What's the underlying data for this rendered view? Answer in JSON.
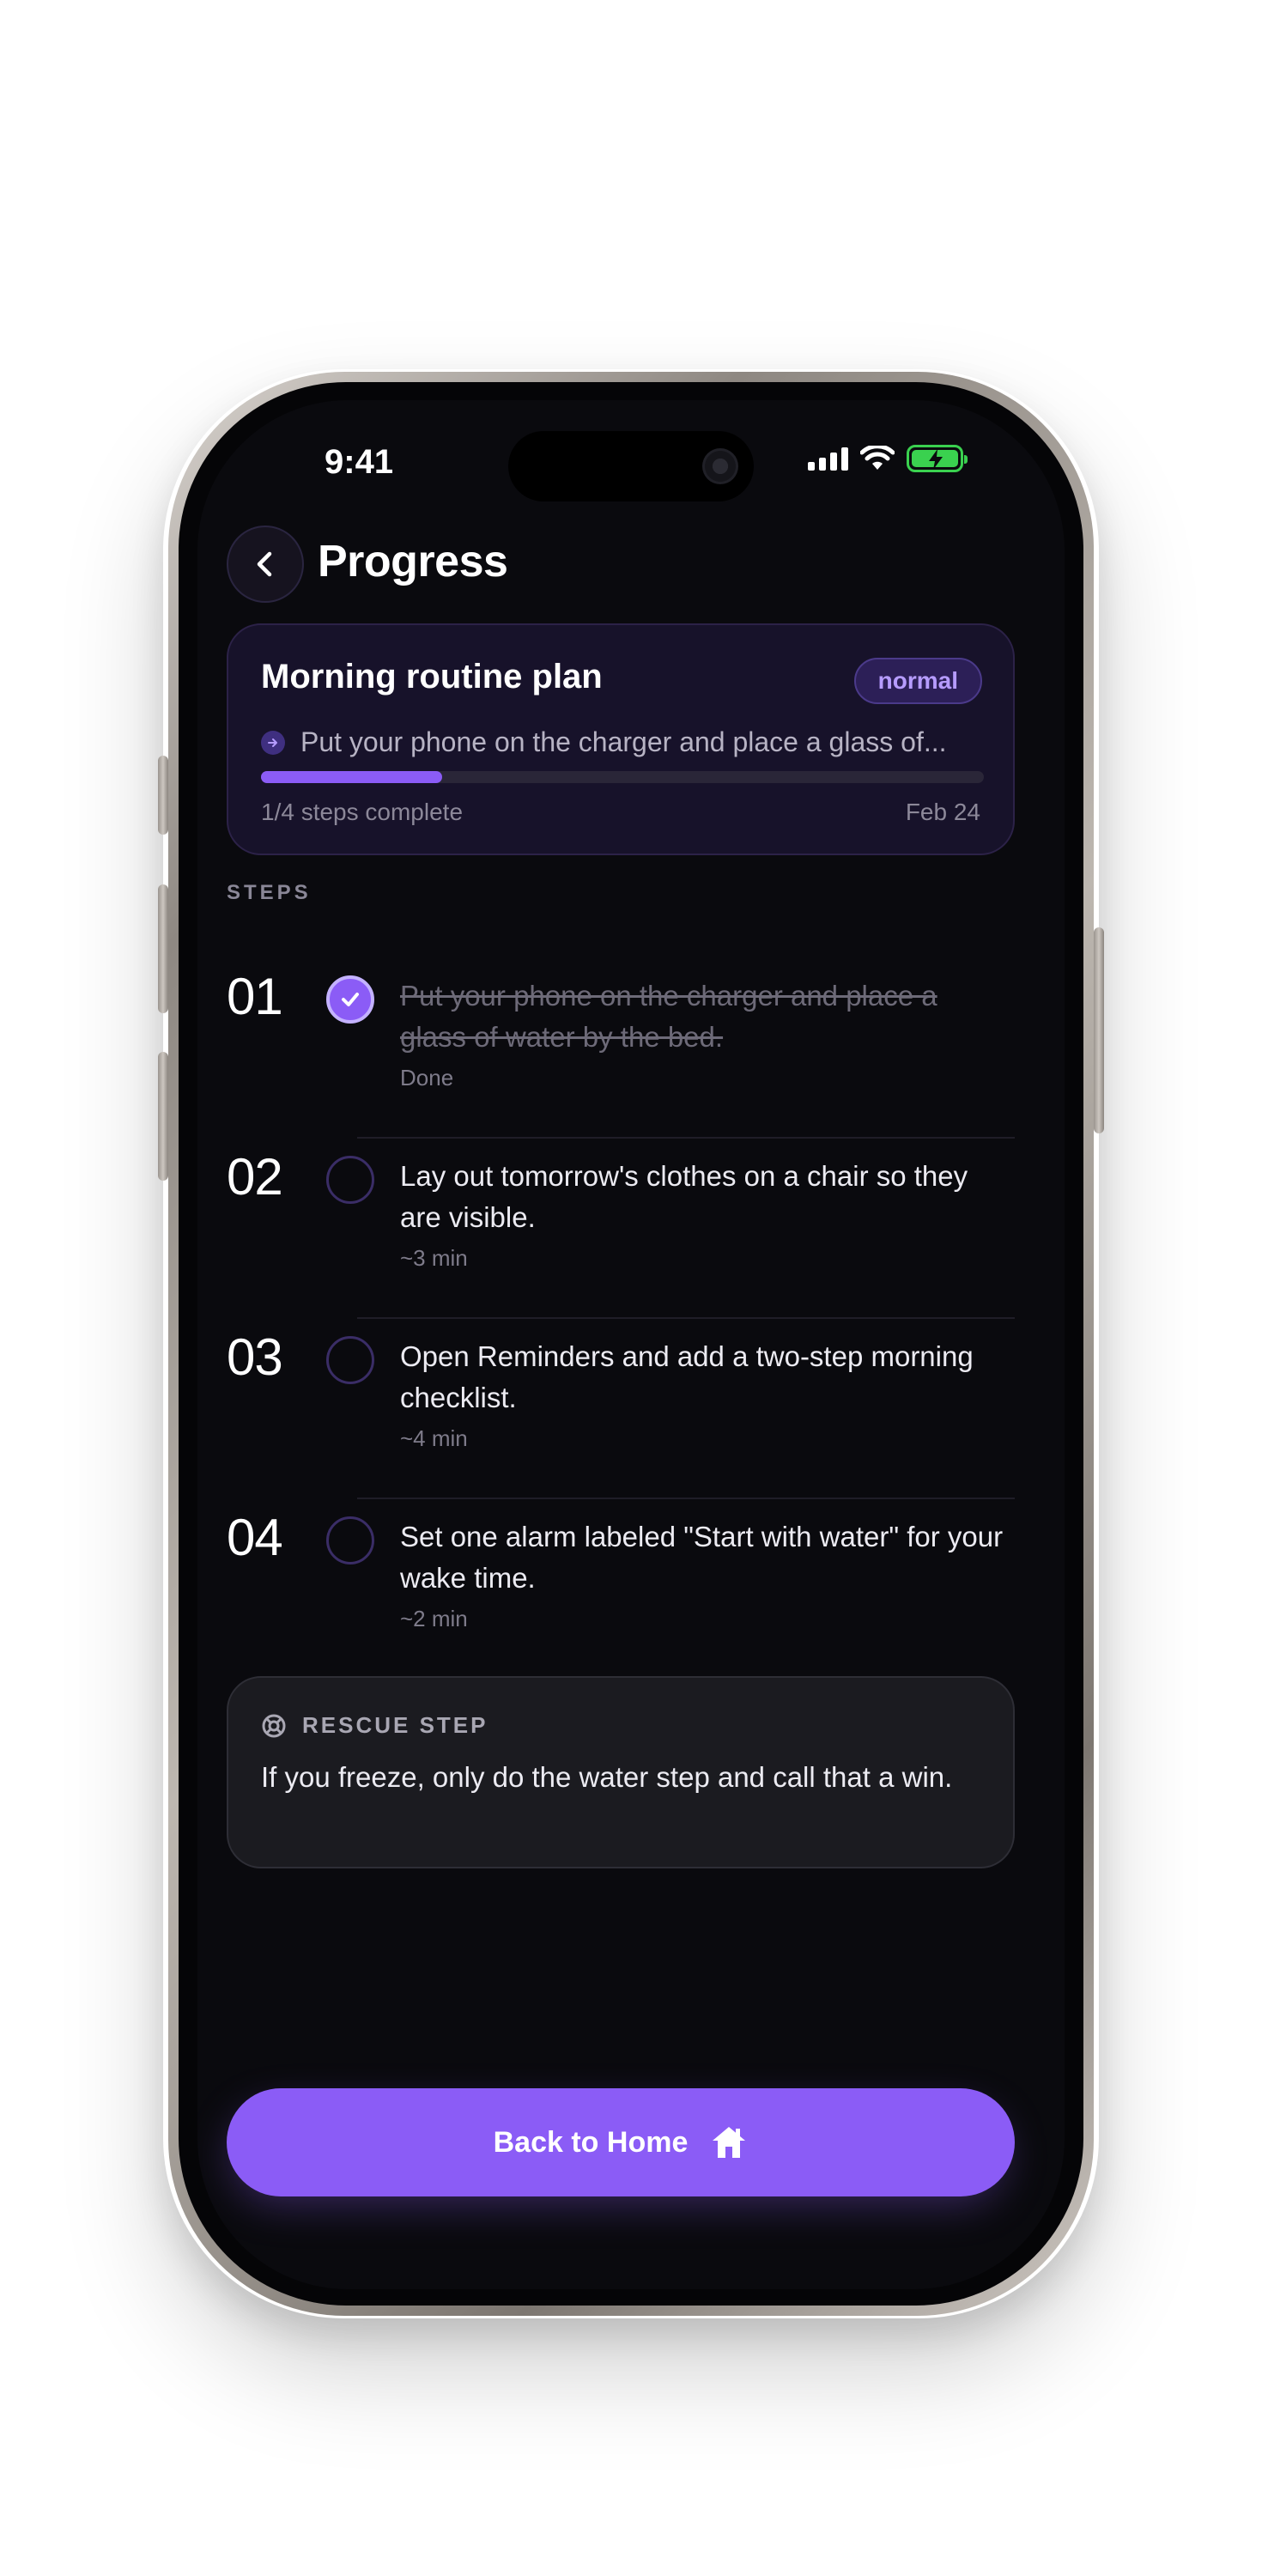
{
  "status_bar": {
    "time": "9:41"
  },
  "header": {
    "title": "Progress"
  },
  "plan": {
    "title": "Morning routine plan",
    "badge": "normal",
    "current_step": "Put your phone on the charger and place a glass of...",
    "progress_fraction": 0.25,
    "progress_label": "1/4 steps complete",
    "date": "Feb 24"
  },
  "steps_section": {
    "label": "STEPS"
  },
  "steps": [
    {
      "number": "01",
      "text": "Put your phone on the charger and place a glass of water by the bed.",
      "meta": "Done",
      "done": true
    },
    {
      "number": "02",
      "text": "Lay out tomorrow's clothes on a chair so they are visible.",
      "meta": "~3 min",
      "done": false
    },
    {
      "number": "03",
      "text": "Open Reminders and add a two-step morning checklist.",
      "meta": "~4 min",
      "done": false
    },
    {
      "number": "04",
      "text": "Set one alarm labeled \"Start with water\" for your wake time.",
      "meta": "~2 min",
      "done": false
    }
  ],
  "rescue": {
    "label": "RESCUE STEP",
    "text": "If you freeze, only do the water step and call that a win."
  },
  "cta": {
    "label": "Back to Home"
  },
  "colors": {
    "accent": "#8b5cf6",
    "background": "#0a0a0e",
    "battery": "#3ad14f"
  },
  "icons": {
    "back": "chevron-left-icon",
    "check": "checkmark-icon",
    "rescue": "lifebuoy-icon",
    "home": "home-icon",
    "step_arrow": "arrow-right-icon"
  }
}
